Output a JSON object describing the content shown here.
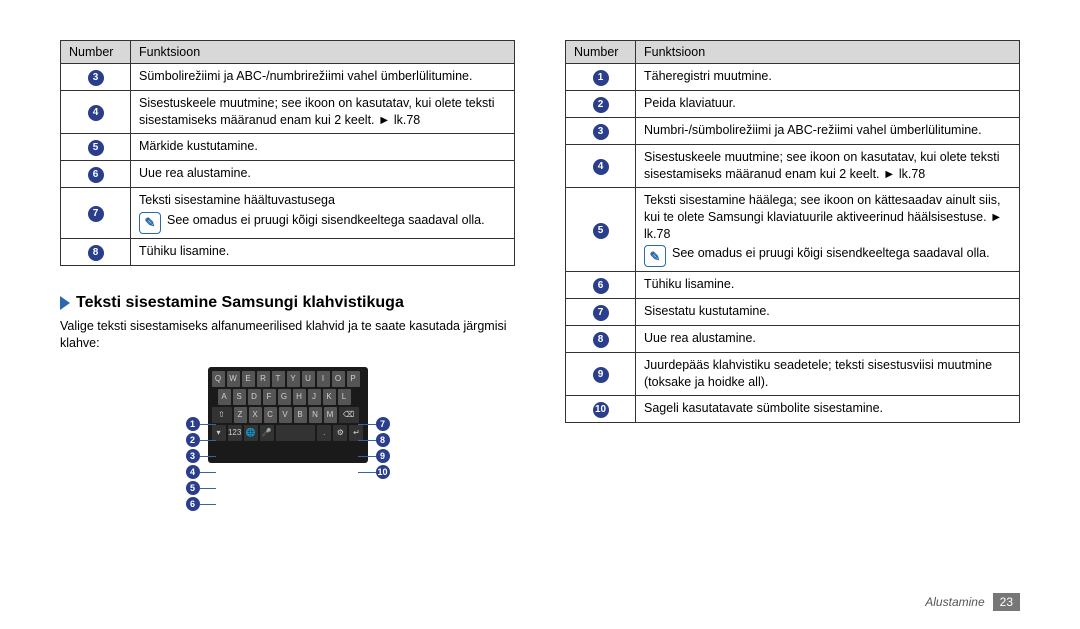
{
  "left": {
    "table_headers": {
      "num": "Number",
      "func": "Funktsioon"
    },
    "rows": [
      {
        "n": "3",
        "t": "Sümbolirežiimi ja ABC-/numbrirežiimi vahel ümberlülitumine."
      },
      {
        "n": "4",
        "t": "Sisestuskeele muutmine; see ikoon on kasutatav, kui olete teksti sisestamiseks määranud enam kui 2 keelt. ► lk.78"
      },
      {
        "n": "5",
        "t": "Märkide kustutamine."
      },
      {
        "n": "6",
        "t": "Uue rea alustamine."
      },
      {
        "n": "7",
        "t": "Teksti sisestamine häältuvastusega",
        "note": "See omadus ei pruugi kõigi sisendkeeltega saadaval olla."
      },
      {
        "n": "8",
        "t": "Tühiku lisamine."
      }
    ],
    "heading": "Teksti sisestamine Samsungi klahvistikuga",
    "body": "Valige teksti sisestamiseks alfanumeerilised klahvid ja te saate kasutada järgmisi klahve:",
    "kb_rows": {
      "r1": [
        "Q",
        "W",
        "E",
        "R",
        "T",
        "Y",
        "U",
        "I",
        "O",
        "P"
      ],
      "r2": [
        "A",
        "S",
        "D",
        "F",
        "G",
        "H",
        "J",
        "K",
        "L"
      ],
      "r3": [
        "Z",
        "X",
        "C",
        "V",
        "B",
        "N",
        "M"
      ]
    },
    "callouts_left": [
      "1",
      "2",
      "3",
      "4",
      "5",
      "6"
    ],
    "callouts_right": [
      "7",
      "8",
      "9",
      "10"
    ]
  },
  "right": {
    "table_headers": {
      "num": "Number",
      "func": "Funktsioon"
    },
    "rows": [
      {
        "n": "1",
        "t": "Täheregistri muutmine."
      },
      {
        "n": "2",
        "t": "Peida klaviatuur."
      },
      {
        "n": "3",
        "t": "Numbri-/sümbolirežiimi ja ABC-režiimi vahel ümberlülitumine."
      },
      {
        "n": "4",
        "t": "Sisestuskeele muutmine; see ikoon on kasutatav, kui olete teksti sisestamiseks määranud enam kui 2 keelt. ► lk.78"
      },
      {
        "n": "5",
        "t": "Teksti sisestamine häälega; see ikoon on kättesaadav ainult siis, kui te olete Samsungi klaviatuurile aktiveerinud häälsisestuse. ► lk.78",
        "note": "See omadus ei pruugi kõigi sisendkeeltega saadaval olla."
      },
      {
        "n": "6",
        "t": "Tühiku lisamine."
      },
      {
        "n": "7",
        "t": "Sisestatu kustutamine."
      },
      {
        "n": "8",
        "t": "Uue rea alustamine."
      },
      {
        "n": "9",
        "t": "Juurdepääs klahvistiku seadetele; teksti sisestusviisi muutmine (toksake ja hoidke all)."
      },
      {
        "n": "10",
        "t": "Sageli kasutatavate sümbolite sisestamine."
      }
    ]
  },
  "footer": {
    "section": "Alustamine",
    "page": "23"
  }
}
